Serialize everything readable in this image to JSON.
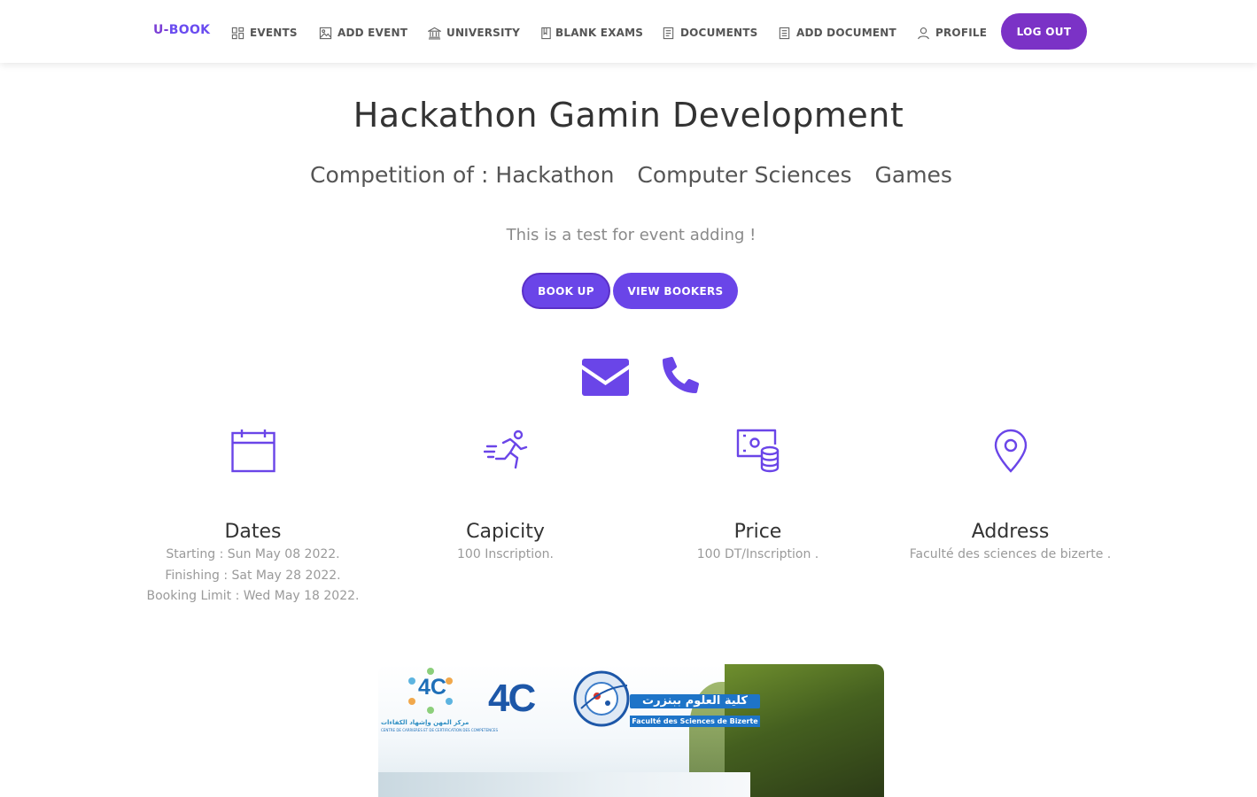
{
  "nav": {
    "brand_prefix": "U-",
    "brand_suffix": "BOOK",
    "items": [
      {
        "label": "EVENTS",
        "icon": "grid-icon"
      },
      {
        "label": "ADD EVENT",
        "icon": "image-icon"
      },
      {
        "label": "UNIVERSITY",
        "icon": "bank-icon"
      },
      {
        "label": "BLANK EXAMS",
        "icon": "book-icon"
      },
      {
        "label": "DOCUMENTS",
        "icon": "document-icon"
      },
      {
        "label": "ADD DOCUMENT",
        "icon": "document-add-icon"
      },
      {
        "label": "PROFILE",
        "icon": "user-icon"
      }
    ],
    "logout_label": "LOG OUT"
  },
  "event": {
    "title": "Hackathon Gamin Development",
    "competition_prefix": "Competition of :",
    "tags": [
      "Hackathon",
      "Computer Sciences",
      "Games"
    ],
    "description": "This is a test for event adding !",
    "book_label": "BOOK UP",
    "view_label": "VIEW BOOKERS"
  },
  "features": {
    "dates": {
      "title": "Dates",
      "starting": "Starting : Sun May 08 2022.",
      "finishing": "Finishing : Sat May 28 2022.",
      "booking_limit": "Booking Limit : Wed May 18 2022."
    },
    "capacity": {
      "title": "Capicity",
      "value": "100 Inscription."
    },
    "price": {
      "title": "Price",
      "value": "100 DT/Inscription ."
    },
    "address": {
      "title": "Address",
      "value": "Faculté des sciences de bizerte ."
    }
  },
  "banner": {
    "logo_text_1": "4C",
    "logo_text_2": "4C",
    "faculty_en": "Faculté des Sciences de Bizerte",
    "faculty_ar": "كلية العلوم ببنزرت",
    "center_caption": "مركز المهن وإشهاد الكفاءات",
    "center_caption_fr": "CENTRE DE CARRIERES ET DE CERTIFICATION DES COMPETENCES"
  },
  "colors": {
    "accent": "#6a45e8",
    "logout": "#7b32c6",
    "icon": "#6a45e8"
  }
}
